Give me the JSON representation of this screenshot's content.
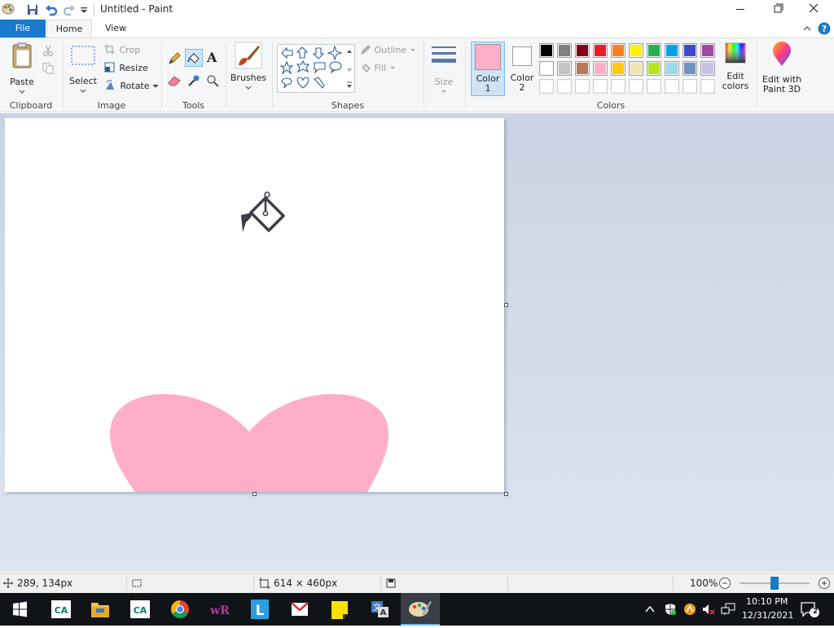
{
  "window": {
    "title": "Untitled - Paint"
  },
  "tabs": {
    "file": "File",
    "home": "Home",
    "view": "View"
  },
  "clipboard": {
    "paste": "Paste",
    "group": "Clipboard"
  },
  "image": {
    "select": "Select",
    "crop": "Crop",
    "resize": "Resize",
    "rotate": "Rotate",
    "group": "Image"
  },
  "tools": {
    "group": "Tools",
    "text_glyph": "A"
  },
  "brushes": {
    "label": "Brushes"
  },
  "shapes": {
    "outline": "Outline",
    "fill": "Fill",
    "group": "Shapes",
    "size": "Size"
  },
  "colors": {
    "color1": "Color 1",
    "color1_l1": "Color",
    "color1_l2": "1",
    "color2_l1": "Color",
    "color2_l2": "2",
    "color1_value": "#ffaec9",
    "color2_value": "#ffffff",
    "edit_l1": "Edit",
    "edit_l2": "colors",
    "group": "Colors",
    "palette_row1": [
      "#000000",
      "#7f7f7f",
      "#880015",
      "#ed1c24",
      "#ff7f27",
      "#fff200",
      "#22b14c",
      "#00a2e8",
      "#3f48cc",
      "#a349a4"
    ],
    "palette_row2": [
      "#ffffff",
      "#c3c3c3",
      "#b97a57",
      "#ffaec9",
      "#ffc90e",
      "#efe4b0",
      "#b5e61d",
      "#99d9ea",
      "#7092be",
      "#c8bfe7"
    ],
    "palette_row3": [
      "#ffffff",
      "#ffffff",
      "#ffffff",
      "#ffffff",
      "#ffffff",
      "#ffffff",
      "#ffffff",
      "#ffffff",
      "#ffffff",
      "#ffffff"
    ]
  },
  "paint3d": {
    "l1": "Edit with",
    "l2": "Paint 3D"
  },
  "canvas": {
    "heart_color": "#ffaec9"
  },
  "status": {
    "cursor": "289, 134px",
    "size": "614 × 460px",
    "zoom": "100%",
    "zoom_level": 0.5
  },
  "taskbar": {
    "time": "10:10 PM",
    "date": "12/31/2021",
    "notifications": "2"
  }
}
